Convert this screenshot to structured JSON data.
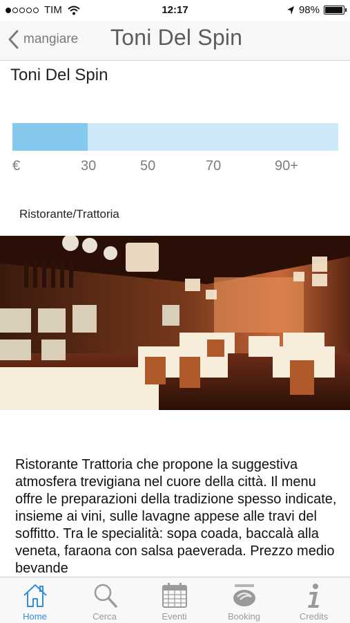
{
  "status_bar": {
    "carrier": "TIM",
    "time": "12:17",
    "battery": "98%",
    "battery_level": 0.98,
    "signal_bars": 1
  },
  "nav": {
    "back_label": "mangiare",
    "title": "Toni Del Spin"
  },
  "restaurant": {
    "name": "Toni Del Spin",
    "price_scale": [
      "€",
      "30",
      "50",
      "70",
      "90+"
    ],
    "price_level_fraction": 0.23,
    "category": "Ristorante/Trattoria",
    "description": "Ristorante Trattoria che propone la suggestiva atmosfera trevigiana nel cuore della città. Il menu offre le preparazioni della tradizione spesso indicate, insieme ai vini, sulle lavagne appese alle travi del soffitto. Tra le specialità: sopa coada, baccalà alla veneta, faraona con salsa paeverada. Prezzo medio bevande"
  },
  "tabs": [
    {
      "label": "Home",
      "icon": "home-icon",
      "active": true
    },
    {
      "label": "Cerca",
      "icon": "search-icon",
      "active": false
    },
    {
      "label": "Eventi",
      "icon": "calendar-icon",
      "active": false
    },
    {
      "label": "Booking",
      "icon": "booking-logo-icon",
      "active": false
    },
    {
      "label": "Credits",
      "icon": "info-icon",
      "active": false
    }
  ],
  "colors": {
    "accent": "#2f8de0",
    "price_fill": "#84c8ee",
    "price_track": "#cde8f8"
  }
}
